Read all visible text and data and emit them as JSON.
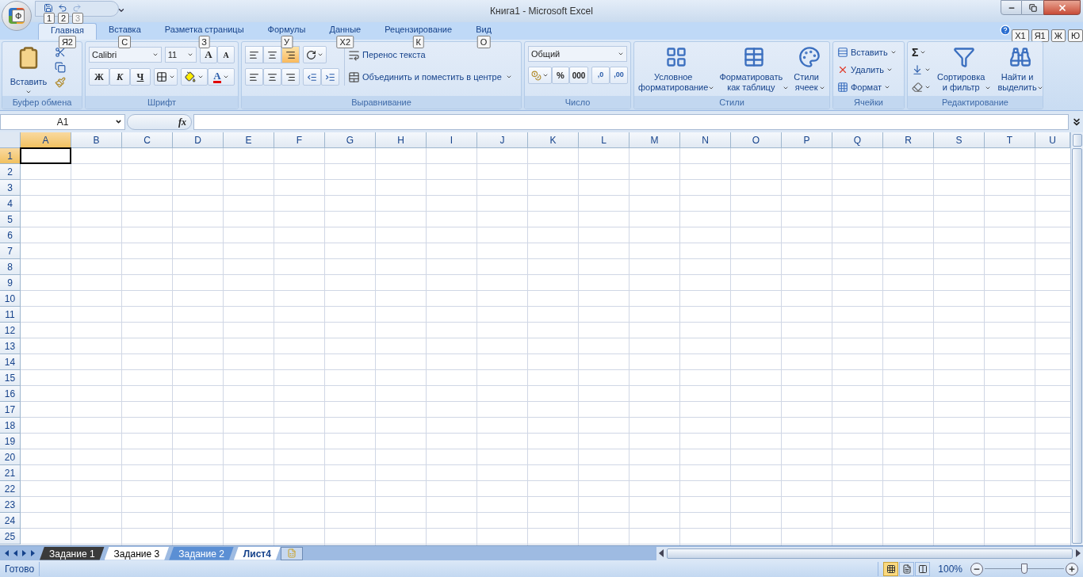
{
  "window": {
    "title": "Книга1 - Microsoft Excel"
  },
  "office_button": {
    "keytip": "Ф"
  },
  "quick_access": [
    {
      "kind": "save",
      "keytip": "1",
      "disabled": false
    },
    {
      "kind": "undo",
      "keytip": "2",
      "disabled": false
    },
    {
      "kind": "redo",
      "keytip": "3",
      "disabled": true
    }
  ],
  "ribbon_tabs": [
    {
      "label": "Главная",
      "keytip": "Я2",
      "selected": true
    },
    {
      "label": "Вставка",
      "keytip": "С",
      "selected": false
    },
    {
      "label": "Разметка страницы",
      "keytip": "З",
      "selected": false
    },
    {
      "label": "Формулы",
      "keytip": "У",
      "selected": false
    },
    {
      "label": "Данные",
      "keytip": "Х2",
      "selected": false
    },
    {
      "label": "Рецензирование",
      "keytip": "К",
      "selected": false
    },
    {
      "label": "Вид",
      "keytip": "О",
      "selected": false
    }
  ],
  "ribbon_keytips": [
    "Х1",
    "Я1",
    "Ж",
    "Ю"
  ],
  "clipboard": {
    "title": "Буфер обмена",
    "paste_label": "Вставить"
  },
  "font": {
    "title": "Шрифт",
    "font_name": "Calibri",
    "font_size": "11",
    "grow_label": "A",
    "shrink_label": "A",
    "style_buttons": [
      {
        "kind": "bold",
        "label": "Ж"
      },
      {
        "kind": "italic",
        "label": "К"
      },
      {
        "kind": "underline",
        "label": "Ч"
      }
    ],
    "color_label": "A"
  },
  "alignment": {
    "title": "Выравнивание",
    "vertical": [
      {
        "kind": "top",
        "selected": false
      },
      {
        "kind": "middle",
        "selected": false
      },
      {
        "kind": "bottom",
        "selected": true
      }
    ],
    "wrap_label": "Перенос текста",
    "merge_label": "Объединить и поместить в центре"
  },
  "number": {
    "title": "Число",
    "format": "Общий",
    "percent_label": "%",
    "thousands_label": "000",
    "decimal_labels": [
      ",0",
      ",00"
    ]
  },
  "styles": {
    "title": "Стили",
    "buttons": [
      {
        "kind": "conditional",
        "label": "Условное\nформатирование"
      },
      {
        "kind": "table",
        "label": "Форматировать\nкак таблицу"
      },
      {
        "kind": "cellstyle",
        "label": "Стили\nячеек"
      }
    ]
  },
  "cells": {
    "title": "Ячейки",
    "buttons": [
      {
        "kind": "insert",
        "label": "Вставить"
      },
      {
        "kind": "delete",
        "label": "Удалить"
      },
      {
        "kind": "format",
        "label": "Формат"
      }
    ]
  },
  "editing": {
    "title": "Редактирование",
    "sum_label": "Σ",
    "buttons": [
      {
        "kind": "sort",
        "label": "Сортировка\nи фильтр"
      },
      {
        "kind": "find",
        "label": "Найти и\nвыделить"
      }
    ]
  },
  "formula_bar": {
    "name_box": "A1",
    "fx_label": "fx"
  },
  "sheet": {
    "columns": [
      {
        "label": "A",
        "selected": true
      },
      {
        "label": "B",
        "selected": false
      },
      {
        "label": "C",
        "selected": false
      },
      {
        "label": "D",
        "selected": false
      },
      {
        "label": "E",
        "selected": false
      },
      {
        "label": "F",
        "selected": false
      },
      {
        "label": "G",
        "selected": false
      },
      {
        "label": "H",
        "selected": false
      },
      {
        "label": "I",
        "selected": false
      },
      {
        "label": "J",
        "selected": false
      },
      {
        "label": "K",
        "selected": false
      },
      {
        "label": "L",
        "selected": false
      },
      {
        "label": "M",
        "selected": false
      },
      {
        "label": "N",
        "selected": false
      },
      {
        "label": "O",
        "selected": false
      },
      {
        "label": "P",
        "selected": false
      },
      {
        "label": "Q",
        "selected": false
      },
      {
        "label": "R",
        "selected": false
      },
      {
        "label": "S",
        "selected": false
      },
      {
        "label": "T",
        "selected": false
      },
      {
        "label": "U",
        "selected": false
      }
    ],
    "rows": [
      {
        "label": "1",
        "selected": true
      },
      {
        "label": "2",
        "selected": false
      },
      {
        "label": "3",
        "selected": false
      },
      {
        "label": "4",
        "selected": false
      },
      {
        "label": "5",
        "selected": false
      },
      {
        "label": "6",
        "selected": false
      },
      {
        "label": "7",
        "selected": false
      },
      {
        "label": "8",
        "selected": false
      },
      {
        "label": "9",
        "selected": false
      },
      {
        "label": "10",
        "selected": false
      },
      {
        "label": "11",
        "selected": false
      },
      {
        "label": "12",
        "selected": false
      },
      {
        "label": "13",
        "selected": false
      },
      {
        "label": "14",
        "selected": false
      },
      {
        "label": "15",
        "selected": false
      },
      {
        "label": "16",
        "selected": false
      },
      {
        "label": "17",
        "selected": false
      },
      {
        "label": "18",
        "selected": false
      },
      {
        "label": "19",
        "selected": false
      },
      {
        "label": "20",
        "selected": false
      },
      {
        "label": "21",
        "selected": false
      },
      {
        "label": "22",
        "selected": false
      },
      {
        "label": "23",
        "selected": false
      },
      {
        "label": "24",
        "selected": false
      },
      {
        "label": "25",
        "selected": false
      }
    ]
  },
  "sheet_tabs": [
    {
      "label": "Задание 1",
      "color": "#3a3a3a",
      "selected": false
    },
    {
      "label": "Задание 3",
      "color": "#ffffff",
      "selected": false
    },
    {
      "label": "Задание 2",
      "color": "#5b8fd4",
      "selected": false
    },
    {
      "label": "Лист4",
      "color": "#ffffff",
      "selected": true
    }
  ],
  "status_bar": {
    "text": "Готово",
    "views": [
      {
        "kind": "normal",
        "selected": true
      },
      {
        "kind": "layout",
        "selected": false
      },
      {
        "kind": "pagebreak",
        "selected": false
      }
    ],
    "zoom": "100%",
    "zoom_slider": {
      "level": 0.5
    }
  }
}
